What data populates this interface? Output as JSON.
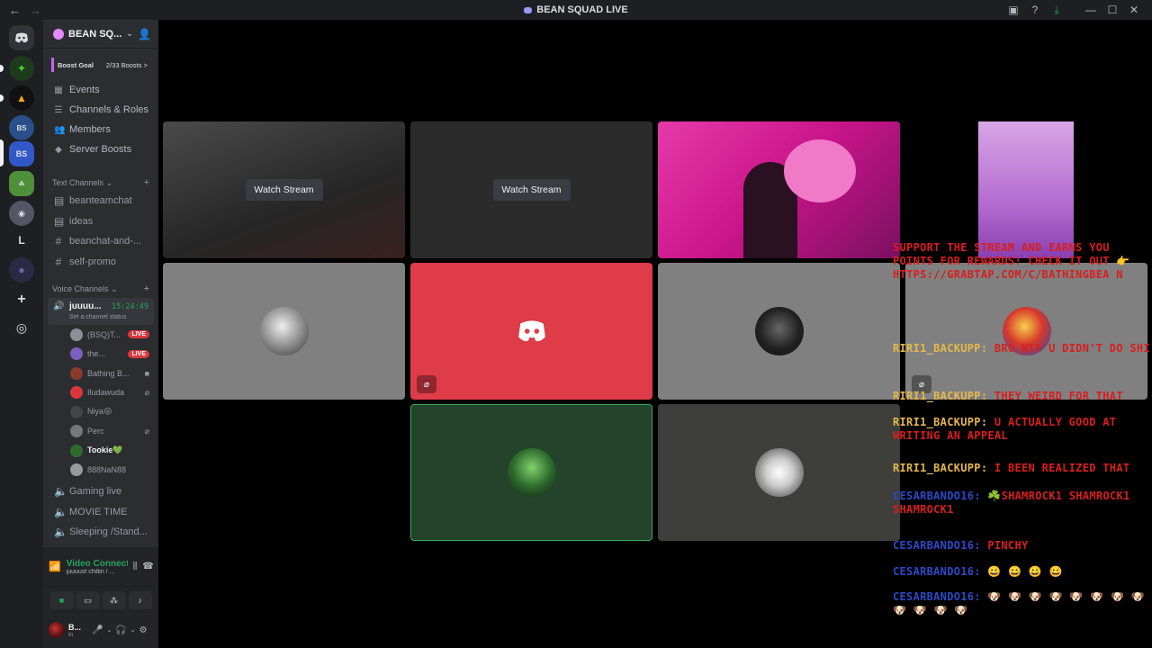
{
  "titlebar": {
    "title": "BEAN SQUAD LIVE",
    "back": "←",
    "forward": "→",
    "icons": [
      "inbox-icon",
      "help-icon",
      "download-icon"
    ],
    "window": {
      "minimize": "—",
      "maximize": "☐",
      "close": "✕"
    }
  },
  "rail": {
    "servers": [
      "discord-home",
      "razer-server",
      "flame-server",
      "bean-squad-server",
      "bsq-server",
      "green-server",
      "profile-server",
      "L",
      "orb-server"
    ],
    "letter_server": "L",
    "add": "+",
    "explore": "◎"
  },
  "sidebar": {
    "server_name": "BEAN SQ...",
    "boost_goal": "Boost Goal",
    "boost_count": "2/33 Boosts",
    "boost_arrow": ">",
    "nav": [
      {
        "label": "Events",
        "icon": "calendar-icon"
      },
      {
        "label": "Channels & Roles",
        "icon": "channels-icon"
      },
      {
        "label": "Members",
        "icon": "members-icon"
      },
      {
        "label": "Server Boosts",
        "icon": "boost-icon"
      }
    ],
    "text_category": "Text Channels",
    "text_channels": [
      "beanteamchat",
      "ideas",
      "beanchat-and-...",
      "self-promo"
    ],
    "voice_category": "Voice Channels",
    "active_voice": {
      "name": "juuuu...",
      "time": "15:24:49",
      "status": "Set a channel status"
    },
    "voice_users": [
      {
        "name": "(BSQ)T...",
        "badge": "LIVE",
        "color": "#8a8f98"
      },
      {
        "name": "the...",
        "badge": "LIVE",
        "color": "#7a5fbf"
      },
      {
        "name": "Bathing B...",
        "badge": "",
        "icon": "camera-icon",
        "color": "#8b3a2a"
      },
      {
        "name": "Iludawuda",
        "badge": "",
        "icon": "mic-off-icon",
        "color": "#da373c"
      },
      {
        "name": "Niya😝",
        "badge": "",
        "color": "#444"
      },
      {
        "name": "Perc",
        "badge": "",
        "icon": "mic-off-icon",
        "color": "#777"
      },
      {
        "name": "Tookie💚",
        "badge": "",
        "color": "#2f6b2f",
        "bright": true
      },
      {
        "name": "888NaN88",
        "badge": "",
        "color": "#999"
      }
    ],
    "other_voice": [
      "Gaming live",
      "MOVIE TIME",
      "Sleeping /Stand..."
    ]
  },
  "panel": {
    "title": "Video Connected",
    "subtitle": "juuuust chillin / ...",
    "username": "B...",
    "user_status": "In"
  },
  "stage": {
    "watch_label": "Watch Stream",
    "tiles": [
      {
        "kind": "stream",
        "bg": "#3a3a3a"
      },
      {
        "kind": "stream",
        "bg": "#2b2b2b"
      },
      {
        "kind": "video",
        "bg": "#d6208f"
      },
      {
        "kind": "portrait",
        "bg": "#b46cd0"
      },
      {
        "kind": "avatar",
        "bg": "#808080",
        "avatar_color": "#bbbbbb"
      },
      {
        "kind": "discord",
        "bg": "#dd3c48"
      },
      {
        "kind": "avatar",
        "bg": "#808080",
        "avatar_color": "#222222"
      },
      {
        "kind": "avatar",
        "bg": "#23432b",
        "avatar_color": "#3a7d3a"
      },
      {
        "kind": "avatar",
        "bg": "#3e3e3a",
        "avatar_color": "#dddddd"
      }
    ]
  },
  "chat": [
    {
      "user": "",
      "msg": "SUPPORT THE STREAM AND EARNS YOU POINTS FOR REWARDS! CHECK IT OUT 👉 HTTPS://GRABTAP.COM/C/BATHINGBEA N",
      "blue": false
    },
    {
      "user": "RIRI1_BACKUPP:",
      "msg": "BRO WTF U DIDN'T DO SHI",
      "blue": false
    },
    {
      "user": "RIRI1_BACKUPP:",
      "msg": "THEY WEIRD FOR THAT",
      "blue": false
    },
    {
      "user": "RIRI1_BACKUPP:",
      "msg": "U ACTUALLY GOOD AT WRITING AN APPEAL",
      "blue": false
    },
    {
      "user": "RIRI1_BACKUPP:",
      "msg": "I BEEN REALIZED THAT",
      "blue": false
    },
    {
      "user": "CESARBANDO16:",
      "msg": "☘️SHAMROCK1 SHAMROCK1 SHAMROCK1",
      "blue": true
    },
    {
      "user": "CESARBANDO16:",
      "msg": "PINCHY",
      "blue": true
    },
    {
      "user": "CESARBANDO16:",
      "msg": "😀 😀 😀 😀",
      "blue": true
    },
    {
      "user": "CESARBANDO16:",
      "msg": "🐶 🐶 🐶 🐶 🐶 🐶 🐶 🐶 🐶 🐶 🐶 🐶",
      "blue": true
    }
  ]
}
